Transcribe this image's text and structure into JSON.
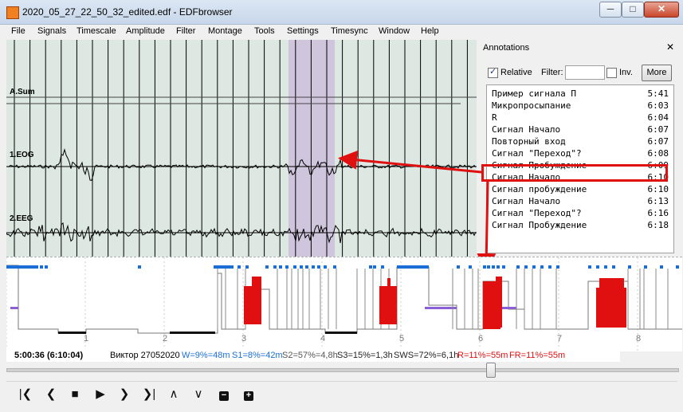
{
  "window": {
    "title": "2020_05_27_22_50_32_edited.edf - EDFbrowser",
    "minimize": "─",
    "maximize": "□",
    "close": "✕"
  },
  "menu": [
    "File",
    "Signals",
    "Timescale",
    "Amplitude",
    "Filter",
    "Montage",
    "Tools",
    "Settings",
    "Timesync",
    "Window",
    "Help"
  ],
  "signals": {
    "labels": [
      "A.Sum",
      "1.EOG",
      "2.EEG"
    ]
  },
  "hypnogram": {
    "ticks": [
      "1",
      "2",
      "3",
      "4",
      "5",
      "6",
      "7",
      "8"
    ]
  },
  "annotations": {
    "title": "Annotations",
    "close": "✕",
    "relative_label": "Relative",
    "relative_checked": true,
    "filter_label": "Filter:",
    "filter_value": "",
    "inverse_label": "Inv.",
    "more_label": "More",
    "items": [
      {
        "name": "Пример сигнала П",
        "time": "5:41"
      },
      {
        "name": "Микропросыпание",
        "time": "6:03"
      },
      {
        "name": "R",
        "time": "6:04"
      },
      {
        "name": "Сигнал Начало",
        "time": "6:07"
      },
      {
        "name": "Повторный вход",
        "time": "6:07"
      },
      {
        "name": "Сигнал \"Переход\"?",
        "time": "6:08"
      },
      {
        "name": "Сигнал Пробуждение",
        "time": "6:09"
      },
      {
        "name": "Сигнал Начало",
        "time": "6:10"
      },
      {
        "name": "Сигнал пробуждение",
        "time": "6:10"
      },
      {
        "name": "Сигнал Начало",
        "time": "6:13"
      },
      {
        "name": "Сигнал \"Переход\"?",
        "time": "6:16"
      },
      {
        "name": "Сигнал Пробуждение",
        "time": "6:18"
      }
    ]
  },
  "status": {
    "time": "5:00:36 (6:10:04)",
    "patient": "Виктор 27052020",
    "w": "W=9%=48m",
    "s1": "S1=8%=42m",
    "s2": "S2=57%=4,8h",
    "s3": "S3=15%=1,3h",
    "sws": "SWS=72%=6,1h",
    "r": "R=11%=55m",
    "fr": "FR=11%=55m"
  },
  "colors": {
    "w": "#1a6fd6",
    "s1": "#1a6fd6",
    "s2": "#555555",
    "s3": "#222222",
    "sws": "#222222",
    "r": "#e01010",
    "fr": "#e01010",
    "highlight": "#e01010",
    "selection": "#cfc6de"
  },
  "toolbar": {
    "icons": [
      "first-icon",
      "prev-page-icon",
      "stop-icon",
      "play-icon",
      "next-page-icon",
      "last-icon",
      "amp-up-icon",
      "amp-down-icon",
      "zoom-out-icon",
      "zoom-in-icon"
    ]
  }
}
